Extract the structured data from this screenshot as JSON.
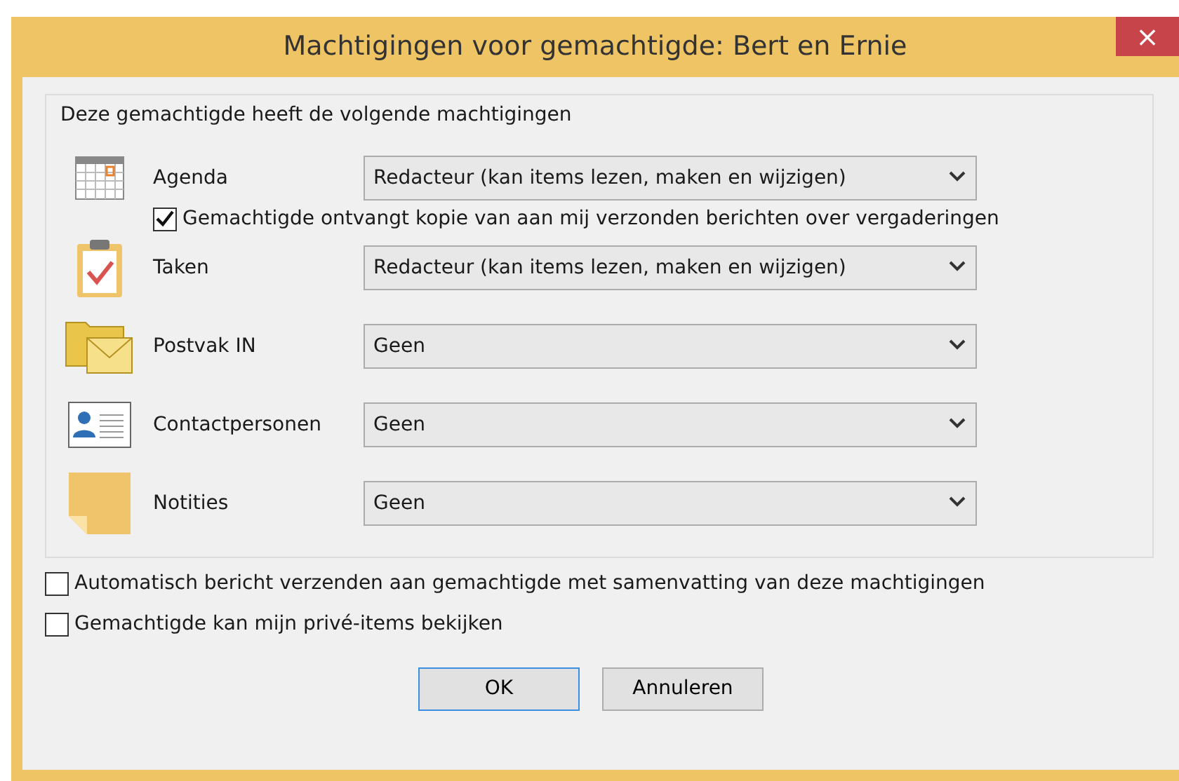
{
  "window": {
    "title": "Machtigingen voor gemachtigde: Bert en Ernie",
    "close": "×"
  },
  "group": {
    "title": "Deze gemachtigde heeft de volgende machtigingen",
    "items": [
      {
        "label": "Agenda",
        "value": "Redacteur (kan items lezen, maken en wijzigen)",
        "option": {
          "label": "Gemachtigde ontvangt kopie van aan mij verzonden berichten over vergaderingen",
          "checked": true
        }
      },
      {
        "label": "Taken",
        "value": "Redacteur (kan items lezen, maken en wijzigen)"
      },
      {
        "label": "Postvak IN",
        "value": "Geen"
      },
      {
        "label": "Contactpersonen",
        "value": "Geen"
      },
      {
        "label": "Notities",
        "value": "Geen"
      }
    ]
  },
  "options": [
    {
      "label": "Automatisch bericht verzenden aan gemachtigde met samenvatting van deze machtigingen",
      "checked": false
    },
    {
      "label": "Gemachtigde kan mijn privé-items bekijken",
      "checked": false
    }
  ],
  "buttons": [
    {
      "label": "OK",
      "default": true
    },
    {
      "label": "Annuleren",
      "default": false
    }
  ]
}
